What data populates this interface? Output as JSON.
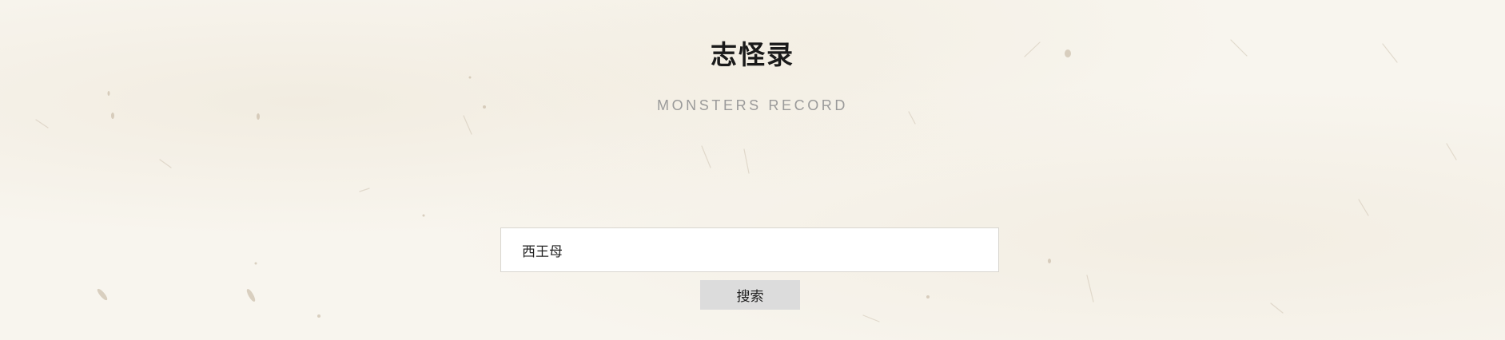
{
  "header": {
    "title": "志怪录",
    "subtitle": "MONSTERS RECORD"
  },
  "search": {
    "value": "西王母",
    "button_label": "搜索"
  },
  "colors": {
    "background": "#f8f5ee",
    "title": "#1a1a1a",
    "subtitle": "#9a9a9a",
    "button_bg": "#dcdcdc",
    "input_border": "#d9d6d0"
  }
}
